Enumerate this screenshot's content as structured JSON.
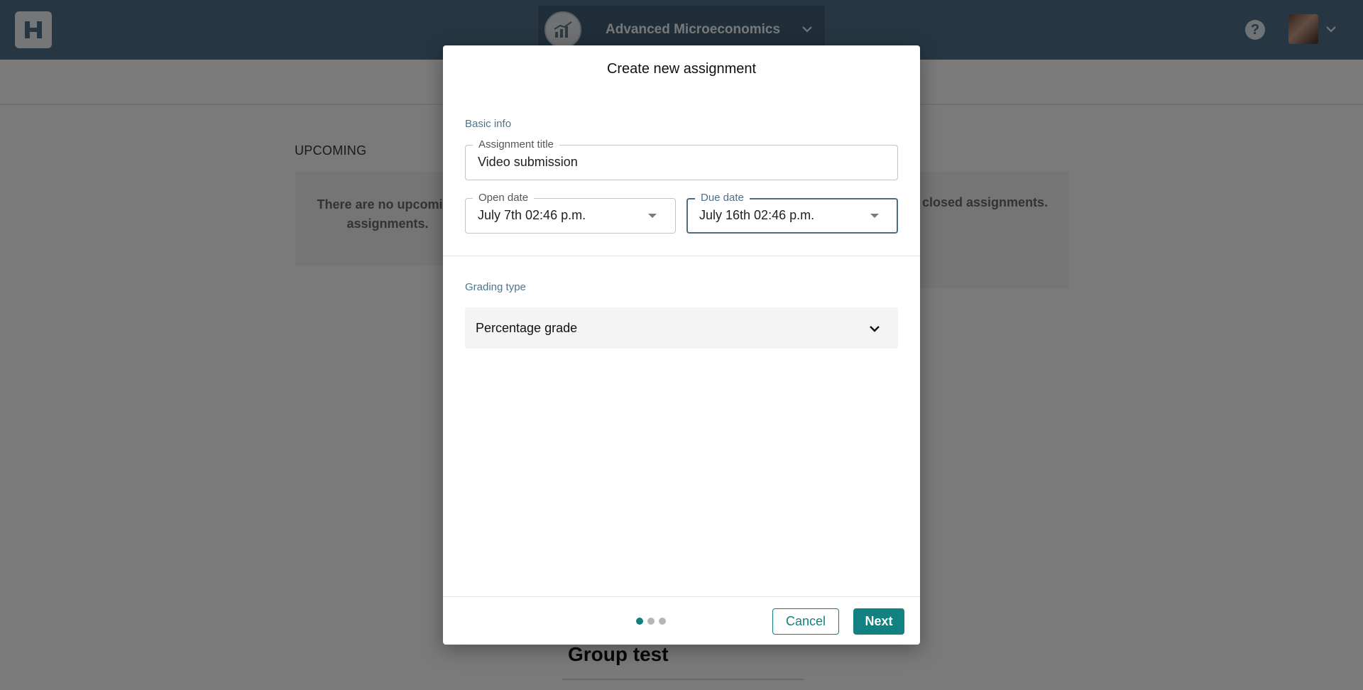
{
  "app": {
    "course_name": "Advanced Microeconomics",
    "upcoming_heading": "UPCOMING",
    "empty_left": "There are no upcoming assignments.",
    "empty_right": "closed assignments.",
    "group_title": "Group test",
    "colors": {
      "header": "#4d6f86",
      "accent": "#137f7f"
    }
  },
  "modal": {
    "title": "Create new assignment",
    "basic_info_label": "Basic info",
    "assignment_title": {
      "label": "Assignment title",
      "value": "Video submission"
    },
    "open_date": {
      "label": "Open date",
      "value": "July 7th 02:46 p.m."
    },
    "due_date": {
      "label": "Due date",
      "value": "July 16th 02:46 p.m."
    },
    "grading_type_label": "Grading type",
    "grading_type_value": "Percentage grade",
    "steps": {
      "total": 3,
      "current": 1
    },
    "cancel_label": "Cancel",
    "next_label": "Next"
  }
}
